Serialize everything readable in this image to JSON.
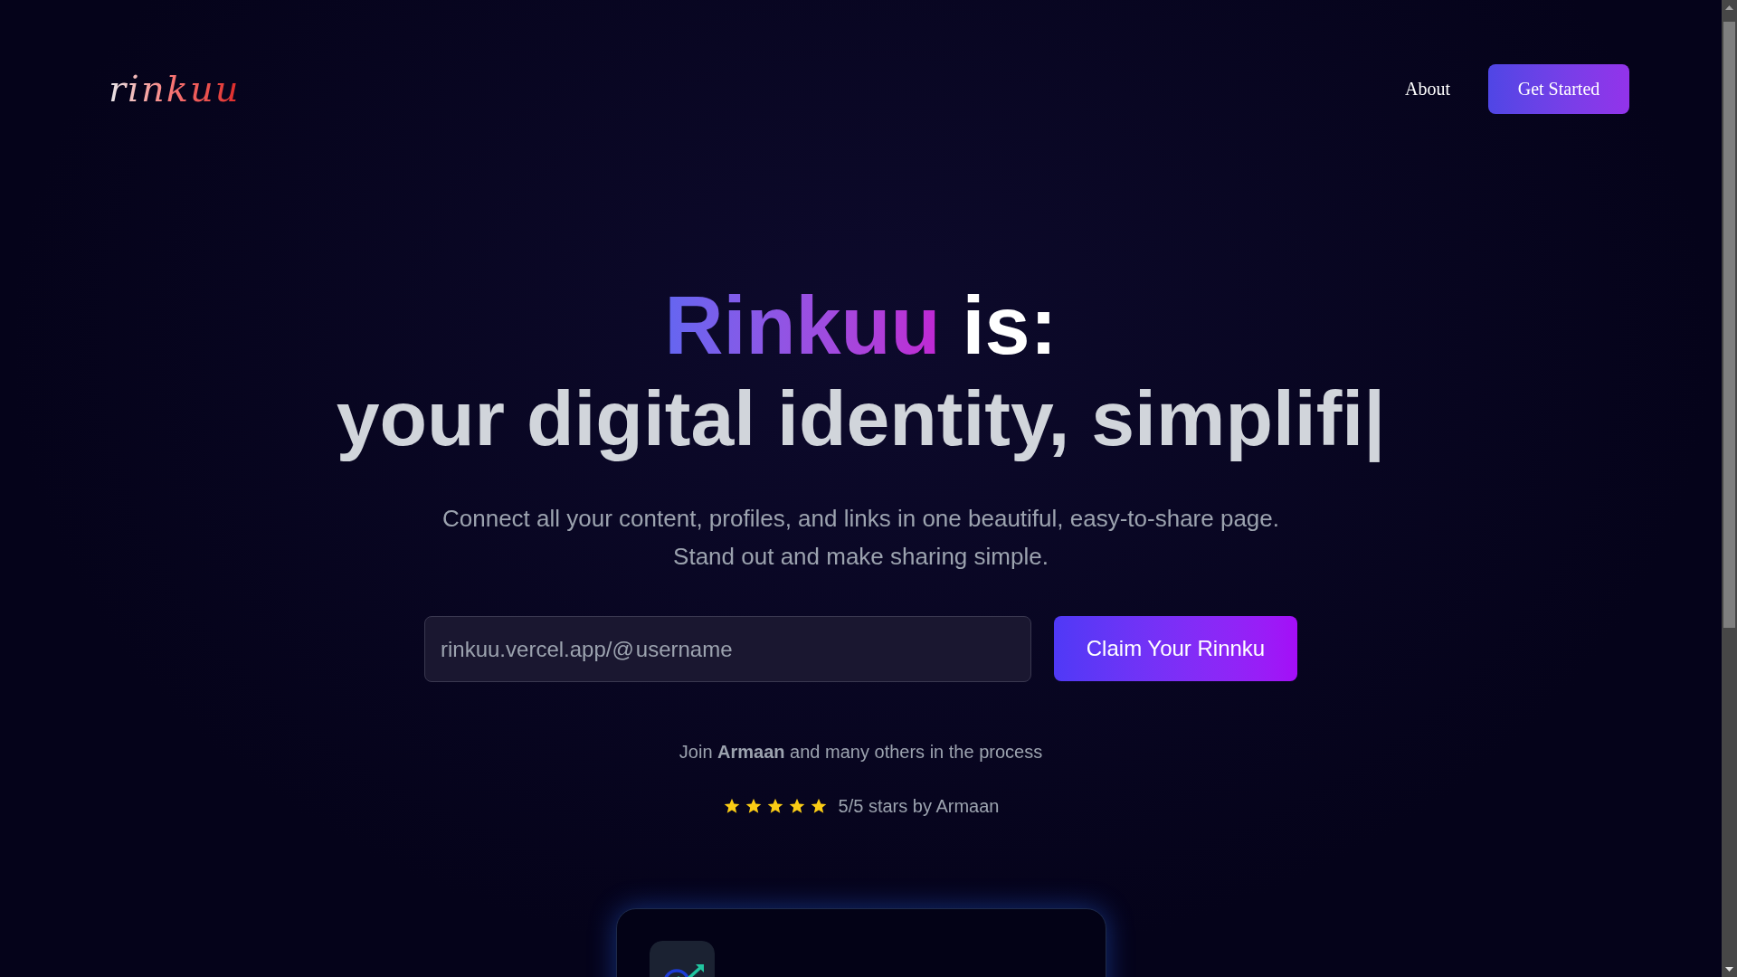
{
  "nav": {
    "logo": "rinkuu",
    "links": [
      "About"
    ],
    "cta": "Get Started"
  },
  "hero": {
    "brand": "Rinkuu",
    "brand_rest": "is:",
    "typed_line": "your digital identity, simplifi|",
    "subtitle": [
      "Connect all your content, profiles, and links in one beautiful, easy-to-share page.",
      "Stand out and make sharing simple."
    ],
    "url_prefix": "rinkuu.vercel.app/@",
    "placeholder": "username",
    "claim_button": "Claim Your Rinnku",
    "social_proof": "Join **Armaan** and many others in the process",
    "rating": {
      "stars": 5,
      "text": "5/5 stars by Armaan"
    }
  }
}
